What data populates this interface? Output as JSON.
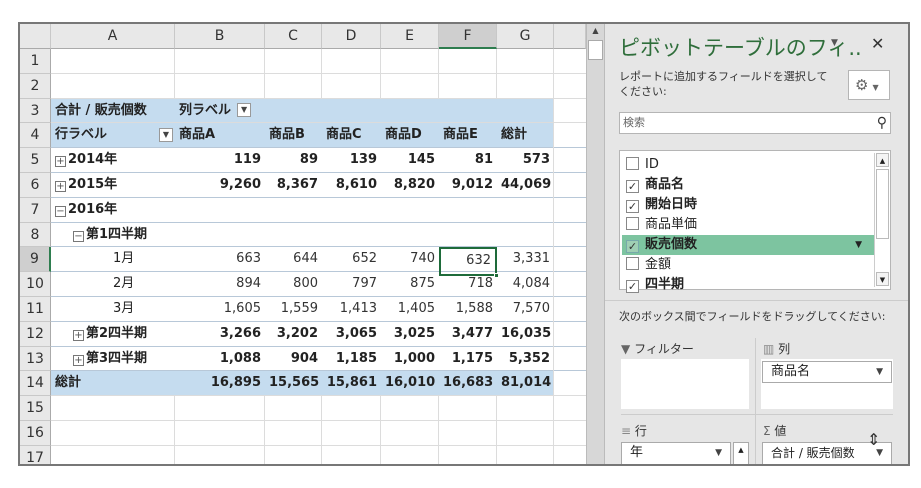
{
  "columns": [
    "A",
    "B",
    "C",
    "D",
    "E",
    "F",
    "G"
  ],
  "rows": [
    "1",
    "2",
    "3",
    "4",
    "5",
    "6",
    "7",
    "8",
    "9",
    "10",
    "11",
    "12",
    "13",
    "14",
    "15",
    "16",
    "17"
  ],
  "pivot": {
    "header_value": "合計 / 販売個数",
    "col_label": "列ラベル",
    "row_label": "行ラベル",
    "products": [
      "商品A",
      "商品B",
      "商品C",
      "商品D",
      "商品E",
      "総計"
    ],
    "lines": [
      {
        "label": "2014年",
        "toggle": "+",
        "indent": 0,
        "bold": true,
        "values": [
          "119",
          "89",
          "139",
          "145",
          "81",
          "573"
        ]
      },
      {
        "label": "2015年",
        "toggle": "+",
        "indent": 0,
        "bold": true,
        "values": [
          "9,260",
          "8,367",
          "8,610",
          "8,820",
          "9,012",
          "44,069"
        ]
      },
      {
        "label": "2016年",
        "toggle": "−",
        "indent": 0,
        "bold": true,
        "values": []
      },
      {
        "label": "第1四半期",
        "toggle": "−",
        "indent": 1,
        "bold": true,
        "values": []
      },
      {
        "label": "1月",
        "toggle": "",
        "indent": 2,
        "bold": false,
        "values": [
          "663",
          "644",
          "652",
          "740",
          "632",
          "3,331"
        ]
      },
      {
        "label": "2月",
        "toggle": "",
        "indent": 2,
        "bold": false,
        "values": [
          "894",
          "800",
          "797",
          "875",
          "718",
          "4,084"
        ]
      },
      {
        "label": "3月",
        "toggle": "",
        "indent": 2,
        "bold": false,
        "values": [
          "1,605",
          "1,559",
          "1,413",
          "1,405",
          "1,588",
          "7,570"
        ]
      },
      {
        "label": "第2四半期",
        "toggle": "+",
        "indent": 1,
        "bold": true,
        "values": [
          "3,266",
          "3,202",
          "3,065",
          "3,025",
          "3,477",
          "16,035"
        ]
      },
      {
        "label": "第3四半期",
        "toggle": "+",
        "indent": 1,
        "bold": true,
        "values": [
          "1,088",
          "904",
          "1,185",
          "1,000",
          "1,175",
          "5,352"
        ]
      }
    ],
    "total_label": "総計",
    "totals": [
      "16,895",
      "15,565",
      "15,861",
      "16,010",
      "16,683",
      "81,014"
    ]
  },
  "selected_cell": "F9",
  "pane": {
    "title": "ピボットテーブルのフィ..",
    "instruction": "レポートに追加するフィールドを選択してください:",
    "search_placeholder": "検索",
    "fields": [
      {
        "label": "ID",
        "checked": false
      },
      {
        "label": "商品名",
        "checked": true
      },
      {
        "label": "開始日時",
        "checked": true
      },
      {
        "label": "商品単価",
        "checked": false
      },
      {
        "label": "販売個数",
        "checked": true,
        "highlighted": true
      },
      {
        "label": "金額",
        "checked": false
      },
      {
        "label": "四半期",
        "checked": true
      }
    ],
    "drag_instruction": "次のボックス間でフィールドをドラッグしてください:",
    "areas": {
      "filter": {
        "label": "フィルター",
        "items": []
      },
      "columns": {
        "label": "列",
        "items": [
          "商品名"
        ]
      },
      "rows": {
        "label": "行",
        "items": [
          "年"
        ]
      },
      "values": {
        "label": "値",
        "items": [
          "合計 / 販売個数"
        ]
      }
    },
    "highlight_color": "#7dc4a0"
  }
}
